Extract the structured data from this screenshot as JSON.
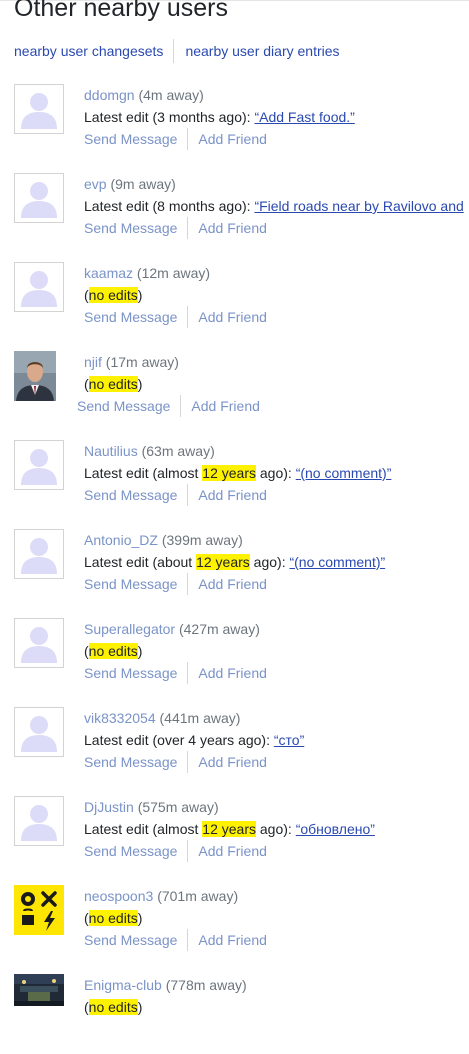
{
  "page": {
    "title": "Other nearby users"
  },
  "subnav": {
    "changesets": "nearby user changesets",
    "diary": "nearby user diary entries"
  },
  "actions": {
    "message": "Send Message",
    "friend": "Add Friend"
  },
  "colors": {
    "link": "#2a49b0",
    "muted_link": "#7a93c8",
    "highlight": "#fff200"
  },
  "users": [
    {
      "name": "ddomgn",
      "distance": "(4m away)",
      "edit_prefix": "Latest edit (3 months ago): ",
      "comment": "“Add Fast food.”"
    },
    {
      "name": "evp",
      "distance": "(9m away)",
      "edit_prefix": "Latest edit (8 months ago): ",
      "comment": "“Field roads near by Ravilovo and"
    },
    {
      "name": "kaamaz",
      "distance": "(12m away)",
      "no_edits": "no edits"
    },
    {
      "name": "njif",
      "distance": "(17m away)",
      "no_edits": "no edits"
    },
    {
      "name": "Nautilius",
      "distance": "(63m away)",
      "edit_pre": "Latest edit (almost ",
      "edit_hl": "12 years",
      "edit_post": " ago): ",
      "comment": "“(no comment)”"
    },
    {
      "name": "Antonio_DZ",
      "distance": "(399m away)",
      "edit_pre": "Latest edit (about ",
      "edit_hl": "12 years",
      "edit_post": " ago): ",
      "comment": "“(no comment)”"
    },
    {
      "name": "Superallegator",
      "distance": "(427m away)",
      "no_edits": "no edits"
    },
    {
      "name": "vik8332054",
      "distance": "(441m away)",
      "edit_prefix": "Latest edit (over 4 years ago): ",
      "comment": "“сто”"
    },
    {
      "name": "DjJustin",
      "distance": "(575m away)",
      "edit_pre": "Latest edit (almost ",
      "edit_hl": "12 years",
      "edit_post": " ago): ",
      "comment": "“обновлено”"
    },
    {
      "name": "neospoon3",
      "distance": "(701m away)",
      "no_edits": "no edits"
    },
    {
      "name": "Enigma-club",
      "distance": "(778m away)",
      "no_edits": "no edits"
    }
  ]
}
